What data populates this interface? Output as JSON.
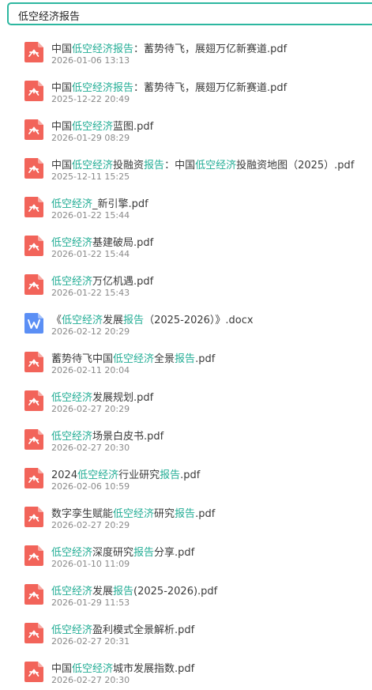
{
  "search": {
    "query": "低空经济报告"
  },
  "colors": {
    "accent": "#2db7a0",
    "highlight": "#22ad95",
    "pdf_icon": "#f2645a",
    "docx_icon": "#5b8ff5"
  },
  "results": [
    {
      "type": "pdf",
      "parts": [
        {
          "t": "中国",
          "h": false
        },
        {
          "t": "低空经济报告",
          "h": true
        },
        {
          "t": "：蓄势待飞，展翅万亿新赛道.pdf",
          "h": false
        }
      ],
      "date": "2026-01-06 13:13"
    },
    {
      "type": "pdf",
      "parts": [
        {
          "t": "中国",
          "h": false
        },
        {
          "t": "低空经济报告",
          "h": true
        },
        {
          "t": "：蓄势待飞，展翅万亿新赛道.pdf",
          "h": false
        }
      ],
      "date": "2025-12-22 20:49"
    },
    {
      "type": "pdf",
      "parts": [
        {
          "t": "中国",
          "h": false
        },
        {
          "t": "低空经济",
          "h": true
        },
        {
          "t": "蓝图.pdf",
          "h": false
        }
      ],
      "date": "2026-01-29 08:29"
    },
    {
      "type": "pdf",
      "parts": [
        {
          "t": "中国",
          "h": false
        },
        {
          "t": "低空经济",
          "h": true
        },
        {
          "t": "投融资",
          "h": false
        },
        {
          "t": "报告",
          "h": true
        },
        {
          "t": "：中国",
          "h": false
        },
        {
          "t": "低空经济",
          "h": true
        },
        {
          "t": "投融资地图（2025）.pdf",
          "h": false
        }
      ],
      "date": "2025-12-11 15:25"
    },
    {
      "type": "pdf",
      "parts": [
        {
          "t": "低空经济",
          "h": true
        },
        {
          "t": "_新引擎.pdf",
          "h": false
        }
      ],
      "date": "2026-01-22 15:44"
    },
    {
      "type": "pdf",
      "parts": [
        {
          "t": "低空经济",
          "h": true
        },
        {
          "t": "基建破局.pdf",
          "h": false
        }
      ],
      "date": "2026-01-22 15:44"
    },
    {
      "type": "pdf",
      "parts": [
        {
          "t": "低空经济",
          "h": true
        },
        {
          "t": "万亿机遇.pdf",
          "h": false
        }
      ],
      "date": "2026-01-22 15:43"
    },
    {
      "type": "docx",
      "parts": [
        {
          "t": "《",
          "h": false
        },
        {
          "t": "低空经济",
          "h": true
        },
        {
          "t": "发展",
          "h": false
        },
        {
          "t": "报告",
          "h": true
        },
        {
          "t": "（2025-2026）》.docx",
          "h": false
        }
      ],
      "date": "2026-02-12 20:29"
    },
    {
      "type": "pdf",
      "parts": [
        {
          "t": "蓄势待飞中国",
          "h": false
        },
        {
          "t": "低空经济",
          "h": true
        },
        {
          "t": "全景",
          "h": false
        },
        {
          "t": "报告",
          "h": true
        },
        {
          "t": ".pdf",
          "h": false
        }
      ],
      "date": "2026-02-11 20:04"
    },
    {
      "type": "pdf",
      "parts": [
        {
          "t": "低空经济",
          "h": true
        },
        {
          "t": "发展规划.pdf",
          "h": false
        }
      ],
      "date": "2026-02-27 20:29"
    },
    {
      "type": "pdf",
      "parts": [
        {
          "t": "低空经济",
          "h": true
        },
        {
          "t": "场景白皮书.pdf",
          "h": false
        }
      ],
      "date": "2026-02-27 20:30"
    },
    {
      "type": "pdf",
      "parts": [
        {
          "t": "2024",
          "h": false
        },
        {
          "t": "低空经济",
          "h": true
        },
        {
          "t": "行业研究",
          "h": false
        },
        {
          "t": "报告",
          "h": true
        },
        {
          "t": ".pdf",
          "h": false
        }
      ],
      "date": "2026-02-06 10:59"
    },
    {
      "type": "pdf",
      "parts": [
        {
          "t": "数字孪生赋能",
          "h": false
        },
        {
          "t": "低空经济",
          "h": true
        },
        {
          "t": "研究",
          "h": false
        },
        {
          "t": "报告",
          "h": true
        },
        {
          "t": ".pdf",
          "h": false
        }
      ],
      "date": "2026-02-27 20:29"
    },
    {
      "type": "pdf",
      "parts": [
        {
          "t": "低空经济",
          "h": true
        },
        {
          "t": "深度研究",
          "h": false
        },
        {
          "t": "报告",
          "h": true
        },
        {
          "t": "分享.pdf",
          "h": false
        }
      ],
      "date": "2026-01-10 11:09"
    },
    {
      "type": "pdf",
      "parts": [
        {
          "t": "低空经济",
          "h": true
        },
        {
          "t": "发展",
          "h": false
        },
        {
          "t": "报告",
          "h": true
        },
        {
          "t": "(2025-2026).pdf",
          "h": false
        }
      ],
      "date": "2026-01-29 11:53"
    },
    {
      "type": "pdf",
      "parts": [
        {
          "t": "低空经济",
          "h": true
        },
        {
          "t": "盈利模式全景解析.pdf",
          "h": false
        }
      ],
      "date": "2026-02-27 20:31"
    },
    {
      "type": "pdf",
      "parts": [
        {
          "t": "中国",
          "h": false
        },
        {
          "t": "低空经济",
          "h": true
        },
        {
          "t": "城市发展指数.pdf",
          "h": false
        }
      ],
      "date": "2026-02-27 20:30"
    }
  ]
}
